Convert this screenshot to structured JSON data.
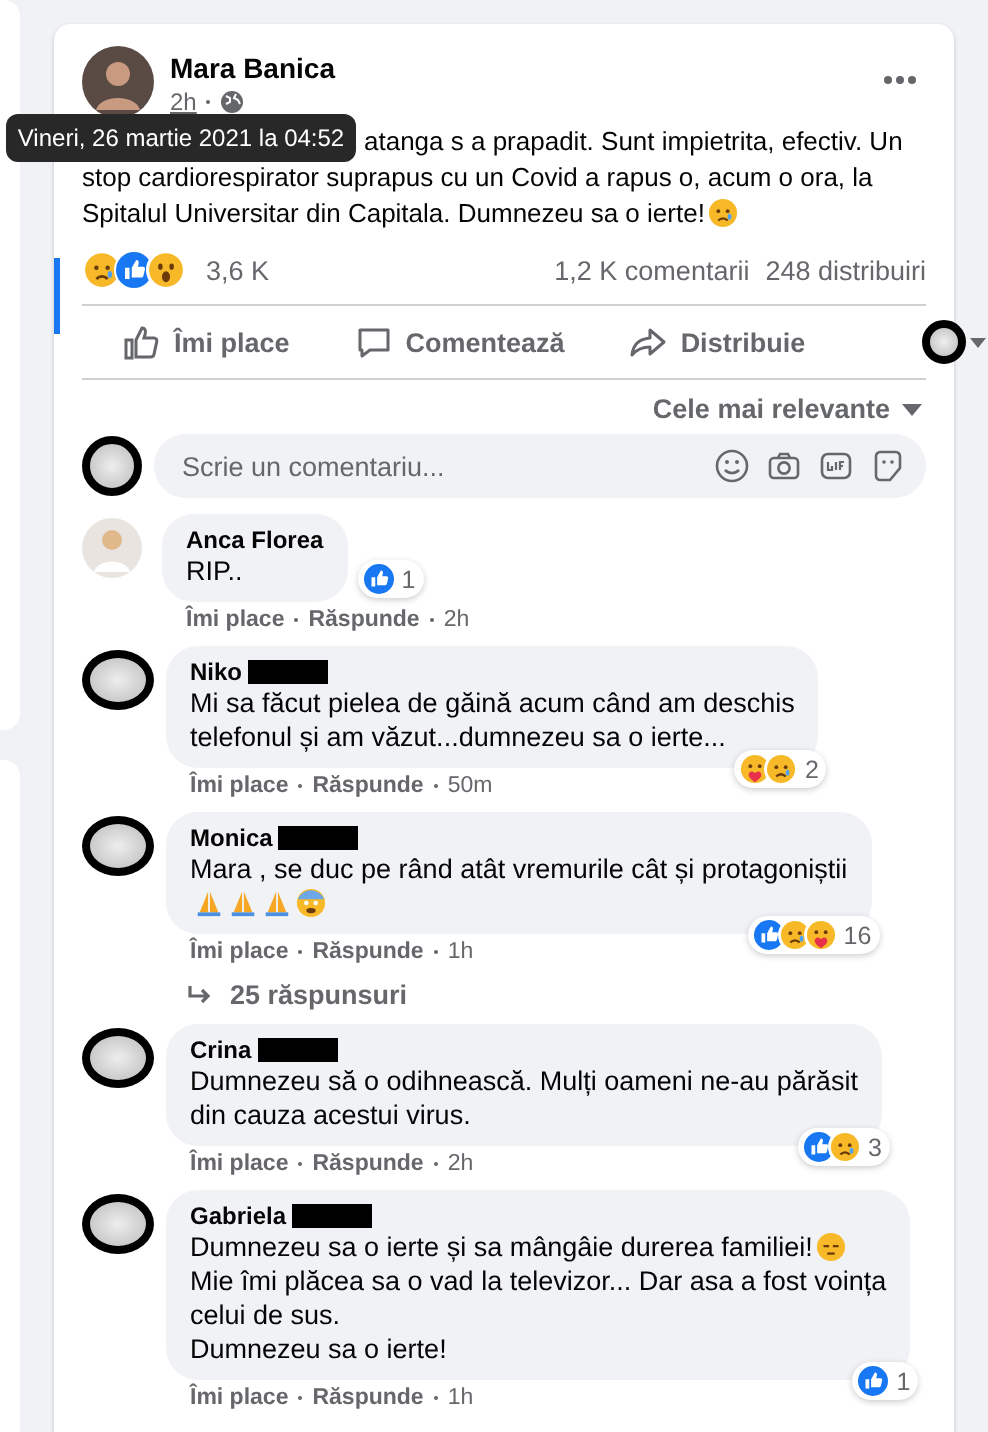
{
  "post": {
    "author": "Mara Banica",
    "time": "2h",
    "tooltip": "Vineri, 26 martie 2021 la 04:52",
    "text_lines": [
      {
        "text": "atanga s a prapadit. Sunt impietrita, efectiv. Un"
      },
      {
        "text": "stop cardiorespirator suprapus cu un Covid a rapus o, acum o ora, la"
      },
      {
        "text": "Spitalul Universitar din Capitala. Dumnezeu sa o ierte!",
        "emojis": [
          {
            "kind": "sad"
          }
        ]
      }
    ],
    "reactions": [
      {
        "kind": "sad"
      },
      {
        "kind": "like"
      },
      {
        "kind": "wow"
      }
    ],
    "reaction_count": "3,6 K",
    "comments_count": "1,2 K comentarii",
    "shares_count": "248 distribuiri"
  },
  "actions": [
    {
      "kind": "like",
      "label": "Îmi place"
    },
    {
      "kind": "comment",
      "label": "Comentează"
    },
    {
      "kind": "share",
      "label": "Distribuie"
    }
  ],
  "sort": "Cele mai relevante",
  "comment_box": {
    "placeholder": "Scrie un comentariu..."
  },
  "comments": [
    {
      "name": "Anca Florea",
      "redacted": false,
      "avatar_hidden": false,
      "lines": [
        {
          "text": "RIP.."
        }
      ],
      "reactions": [
        {
          "kind": "like"
        }
      ],
      "reaction_count": "1",
      "like": "Îmi place",
      "reply": "Răspunde",
      "time": "2h"
    },
    {
      "name": "Niko",
      "redacted": true,
      "avatar_hidden": true,
      "lines": [
        {
          "text": "Mi sa făcut pielea de găină acum când am deschis"
        },
        {
          "text": "telefonul și am văzut...dumnezeu sa o ierte..."
        }
      ],
      "reactions": [
        {
          "kind": "hug"
        },
        {
          "kind": "sad"
        }
      ],
      "reaction_count": "2",
      "like": "Îmi place",
      "reply": "Răspunde",
      "time": "50m"
    },
    {
      "name": "Monica",
      "redacted": true,
      "avatar_hidden": true,
      "lines": [
        {
          "text": "Mara , se duc pe rând atât vremurile cât și protagoniștii"
        },
        {
          "emojis": [
            {
              "kind": "pray"
            },
            {
              "kind": "pray"
            },
            {
              "kind": "pray"
            },
            {
              "kind": "fear"
            }
          ]
        }
      ],
      "reactions": [
        {
          "kind": "like"
        },
        {
          "kind": "sad"
        },
        {
          "kind": "hug"
        }
      ],
      "reaction_count": "16",
      "like": "Îmi place",
      "reply": "Răspunde",
      "time": "1h",
      "replies": "25 răspunsuri"
    },
    {
      "name": "Crina",
      "redacted": true,
      "avatar_hidden": true,
      "lines": [
        {
          "text": "Dumnezeu să o odihnească. Mulți oameni ne-au părăsit"
        },
        {
          "text": "din cauza acestui virus."
        }
      ],
      "reactions": [
        {
          "kind": "like"
        },
        {
          "kind": "sad"
        }
      ],
      "reaction_count": "3",
      "like": "Îmi place",
      "reply": "Răspunde",
      "time": "2h"
    },
    {
      "name": "Gabriela",
      "redacted": true,
      "avatar_hidden": true,
      "lines": [
        {
          "text": "Dumnezeu sa o ierte și sa mângâie durerea familiei!",
          "emojis": [
            {
              "kind": "pensive"
            }
          ]
        },
        {
          "text": "Mie îmi plăcea sa o vad la televizor... Dar asa a fost voința"
        },
        {
          "text": "celui de sus."
        },
        {
          "text": "Dumnezeu sa o ierte!"
        }
      ],
      "reactions": [
        {
          "kind": "like"
        }
      ],
      "reaction_count": "1",
      "like": "Îmi place",
      "reply": "Răspunde",
      "time": "1h"
    }
  ]
}
